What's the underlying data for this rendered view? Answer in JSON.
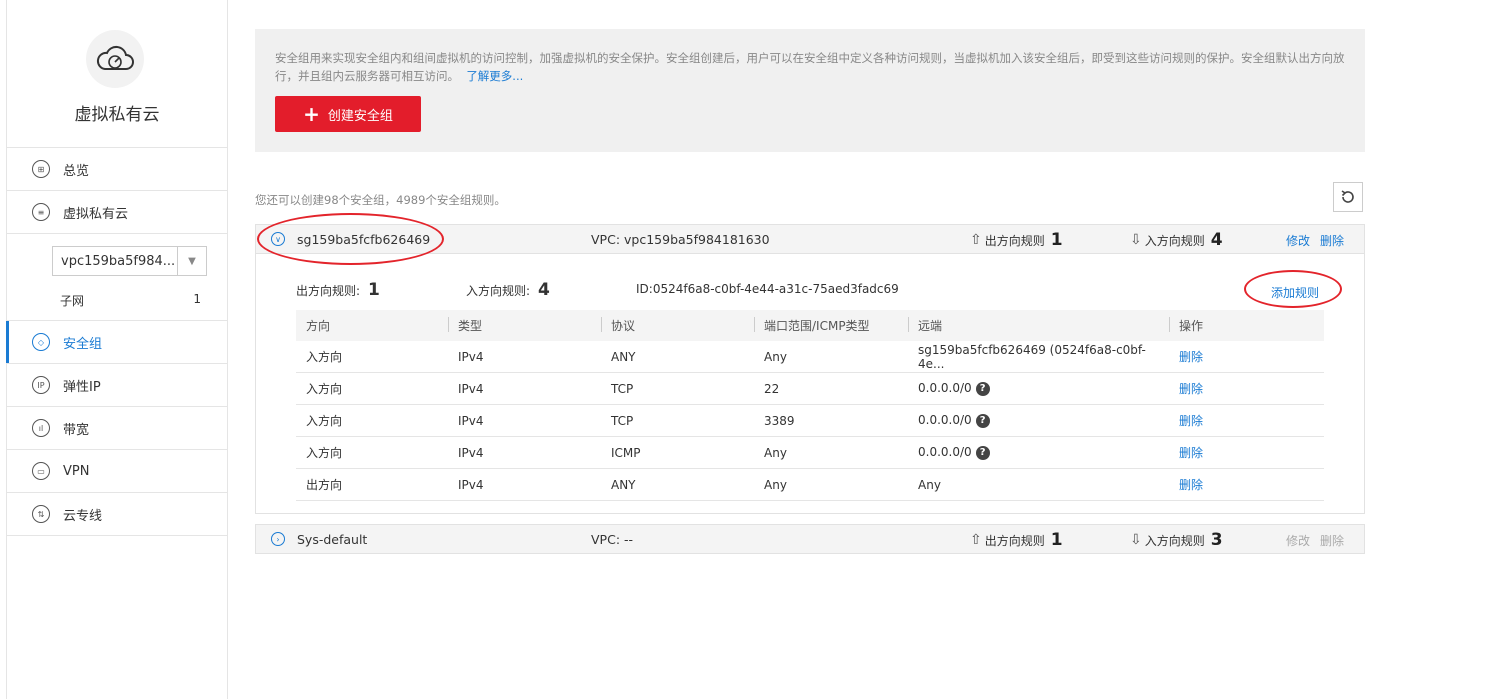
{
  "sidebar": {
    "brand_title": "虚拟私有云",
    "nav": [
      {
        "label": "总览",
        "icon": "overview-icon"
      },
      {
        "label": "虚拟私有云",
        "icon": "list-icon"
      }
    ],
    "vpc_select_value": "vpc159ba5f984...",
    "subnet_label": "子网",
    "subnet_count": "1",
    "nav2": [
      {
        "label": "安全组",
        "icon": "shield-icon",
        "active": true
      },
      {
        "label": "弹性IP",
        "icon": "ip-icon"
      },
      {
        "label": "带宽",
        "icon": "bandwidth-icon"
      },
      {
        "label": "VPN",
        "icon": "vpn-icon"
      },
      {
        "label": "云专线",
        "icon": "direct-connect-icon"
      }
    ]
  },
  "banner": {
    "text": "安全组用来实现安全组内和组间虚拟机的访问控制，加强虚拟机的安全保护。安全组创建后，用户可以在安全组中定义各种访问规则，当虚拟机加入该安全组后，即受到这些访问规则的保护。安全组默认出方向放行，并且组内云服务器可相互访问。",
    "learn_more": "了解更多...",
    "create_button": "创建安全组"
  },
  "quota_text": "您还可以创建98个安全组，4989个安全组规则。",
  "groups": [
    {
      "name": "sg159ba5fcfb626469",
      "vpc": "VPC: vpc159ba5f984181630",
      "out_label": "出方向规则",
      "out_count": "1",
      "in_label": "入方向规则",
      "in_count": "4",
      "edit": "修改",
      "delete": "删除"
    },
    {
      "name": "Sys-default",
      "vpc": "VPC:  --",
      "out_label": "出方向规则",
      "out_count": "1",
      "in_label": "入方向规则",
      "in_count": "3",
      "edit": "修改",
      "delete": "删除"
    }
  ],
  "detail": {
    "out_label": "出方向规则:",
    "out_count": "1",
    "in_label": "入方向规则:",
    "in_count": "4",
    "id": "ID:0524f6a8-c0bf-4e44-a31c-75aed3fadc69",
    "add_rule": "添加规则",
    "columns": [
      "方向",
      "类型",
      "协议",
      "端口范围/ICMP类型",
      "远端",
      "操作"
    ],
    "rows": [
      {
        "direction": "入方向",
        "type": "IPv4",
        "protocol": "ANY",
        "port": "Any",
        "remote": "sg159ba5fcfb626469 (0524f6a8-c0bf-4e...",
        "help": false,
        "action": "删除"
      },
      {
        "direction": "入方向",
        "type": "IPv4",
        "protocol": "TCP",
        "port": "22",
        "remote": "0.0.0.0/0",
        "help": true,
        "action": "删除"
      },
      {
        "direction": "入方向",
        "type": "IPv4",
        "protocol": "TCP",
        "port": "3389",
        "remote": "0.0.0.0/0",
        "help": true,
        "action": "删除"
      },
      {
        "direction": "入方向",
        "type": "IPv4",
        "protocol": "ICMP",
        "port": "Any",
        "remote": "0.0.0.0/0",
        "help": true,
        "action": "删除"
      },
      {
        "direction": "出方向",
        "type": "IPv4",
        "protocol": "ANY",
        "port": "Any",
        "remote": "Any",
        "help": false,
        "action": "删除"
      }
    ]
  },
  "help_glyph": "?",
  "colors": {
    "accent": "#1a7bd3",
    "danger": "#e31d2b",
    "annotation": "#e3242b"
  }
}
